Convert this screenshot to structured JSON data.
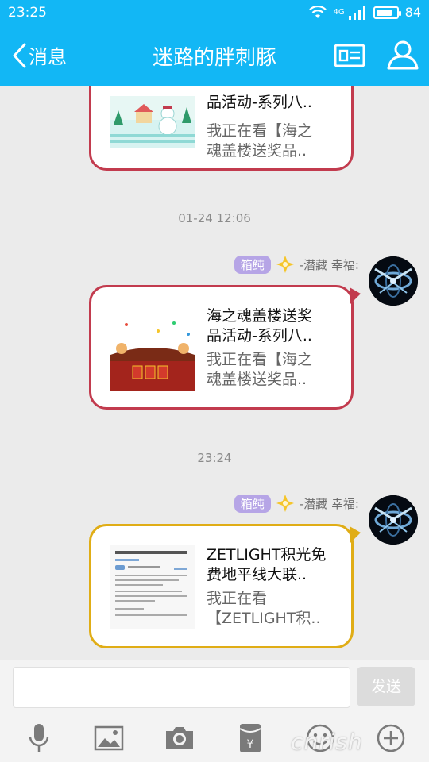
{
  "status": {
    "time": "23:25",
    "signal": "4G",
    "battery": "84",
    "battery_level": 0.84
  },
  "header": {
    "back_label": "消息",
    "title": "迷路的胖刺豚"
  },
  "messages": [
    {
      "title": "品活动-系列八..",
      "desc_line1": "我正在看【海之",
      "desc_line2": "魂盖楼送奖品.."
    },
    {
      "timestamp": "01-24 12:06",
      "badge": "箱鲀",
      "sender": "-潜藏 幸福:",
      "title_line1": "海之魂盖楼送奖",
      "title_line2": "品活动-系列八..",
      "desc_line1": "我正在看【海之",
      "desc_line2": "魂盖楼送奖品.."
    },
    {
      "timestamp": "23:24",
      "badge": "箱鲀",
      "sender": "-潜藏 幸福:",
      "title_line1": "ZETLIGHT积光免",
      "title_line2": "费地平线大联..",
      "desc_line1": "我正在看",
      "desc_line2": "【ZETLIGHT积.."
    }
  ],
  "input": {
    "placeholder": "",
    "send_label": "发送"
  },
  "toolbar": [
    "mic-icon",
    "image-icon",
    "camera-icon",
    "red-packet-icon",
    "emoji-icon",
    "plus-icon"
  ],
  "watermark": "cnrish",
  "colors": {
    "accent": "#12b7f5",
    "red_border": "#c23b4e",
    "gold_border": "#e0ad16",
    "badge": "#b6a5e6"
  }
}
